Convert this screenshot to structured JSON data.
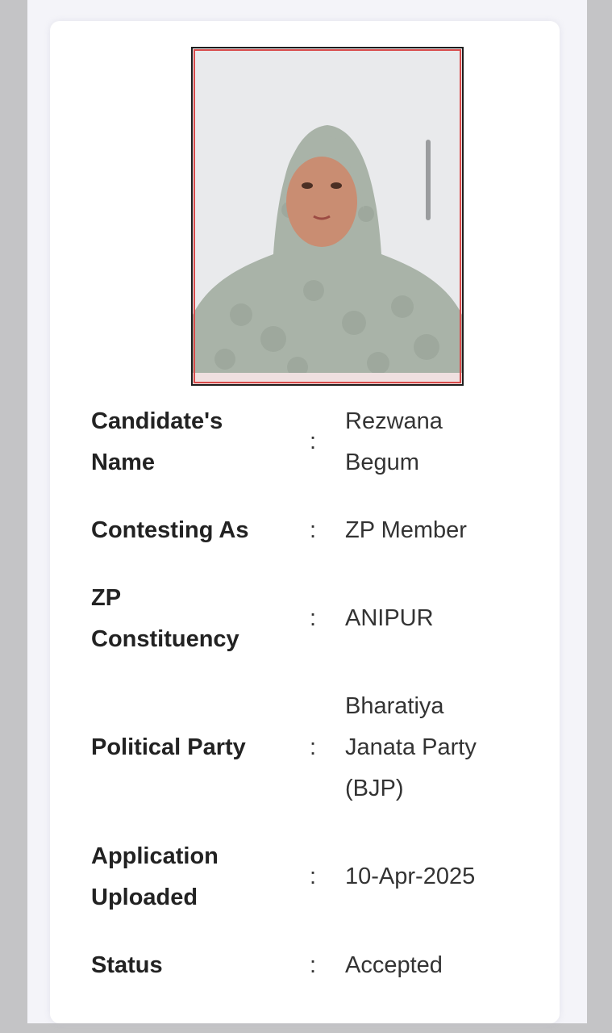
{
  "candidate": {
    "photo_alt": "Candidate photo",
    "fields": [
      {
        "label": "Candidate's Name",
        "value": "Rezwana Begum"
      },
      {
        "label": "Contesting As",
        "value": "ZP Member"
      },
      {
        "label": "ZP Constituency",
        "value": "ANIPUR"
      },
      {
        "label": "Political Party",
        "value": "Bharatiya Janata Party (BJP)"
      },
      {
        "label": "Application Uploaded",
        "value": "10-Apr-2025"
      },
      {
        "label": "Status",
        "value": "Accepted"
      }
    ],
    "separator": ":"
  },
  "colors": {
    "page_background": "#f4f4f9",
    "card_background": "#ffffff",
    "photo_border": "#1e1e1e",
    "photo_inner_border": "#d84a4a"
  }
}
